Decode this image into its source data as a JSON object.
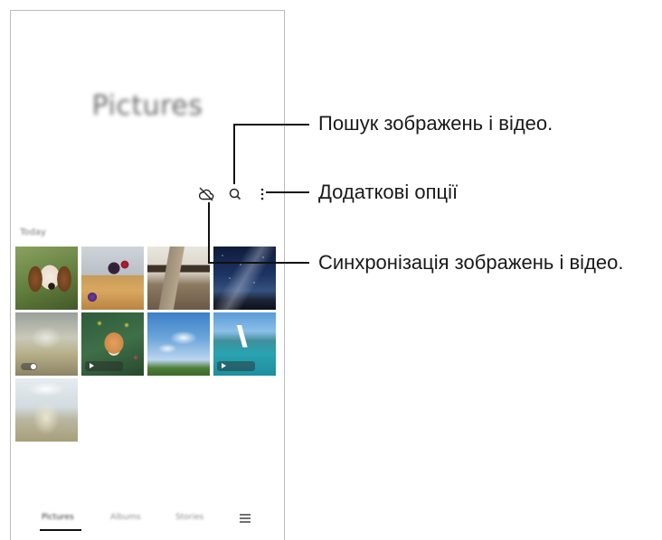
{
  "app": {
    "title": "Pictures",
    "section_label": "Today",
    "toolbar": {
      "sync_icon": "cloud-off-icon",
      "search_icon": "search-icon",
      "more_icon": "more-vertical-icon"
    }
  },
  "tabs": [
    {
      "label": "Pictures",
      "active": true
    },
    {
      "label": "Albums",
      "active": false
    },
    {
      "label": "Stories",
      "active": false
    }
  ],
  "menu_icon": "hamburger-menu-icon",
  "thumbnails": [
    {
      "subject": "beagle puppy",
      "badge": "none"
    },
    {
      "subject": "pancakes with berries",
      "badge": "none"
    },
    {
      "subject": "traditional village street",
      "badge": "none"
    },
    {
      "subject": "starry night sky",
      "badge": "none"
    },
    {
      "subject": "splashing water glass",
      "badge": "toggle"
    },
    {
      "subject": "corgi with flowers",
      "badge": "video"
    },
    {
      "subject": "blue sky over meadow",
      "badge": "none"
    },
    {
      "subject": "sailboat on sea",
      "badge": "video"
    },
    {
      "subject": "glass with ice splash",
      "badge": "none"
    }
  ],
  "callouts": {
    "search": "Пошук зображень і відео.",
    "more_options": "Додаткові опції",
    "sync": "Синхронізація зображень і відео."
  },
  "colors": {
    "frame_border": "#bdbdbd",
    "leader_line": "#111111",
    "callout_text": "#1a1a1a"
  }
}
